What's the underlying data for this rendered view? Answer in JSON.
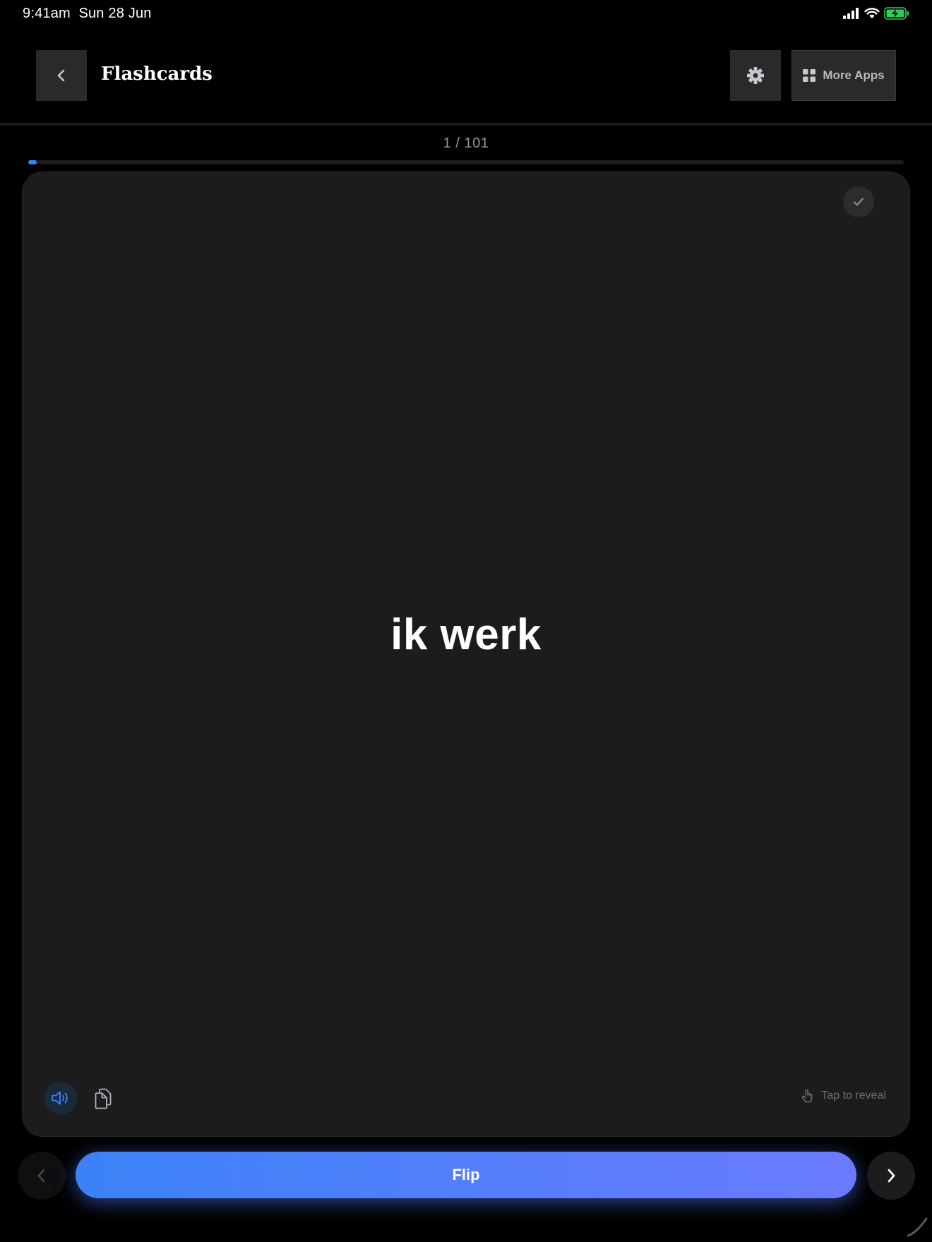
{
  "status_bar": {
    "time": "9:41am",
    "date": "Sun 28 Jun",
    "icons": [
      "cellular-signal-icon",
      "wifi-icon",
      "battery-charging-icon"
    ]
  },
  "header": {
    "title": "Flashcards",
    "back_icon": "chevron-left-icon",
    "settings_icon": "gear-icon",
    "more_apps_label": "More Apps",
    "more_apps_icon": "grid-icon"
  },
  "progress": {
    "label": "1 / 101",
    "current": 1,
    "total": 101,
    "fraction": 0.0099,
    "color": "#3b82f6"
  },
  "card": {
    "word": "ik werk",
    "mark_known_icon": "check-icon",
    "audio_icon": "speaker-icon",
    "copy_icon": "copy-icon",
    "reveal_hint": "Tap to reveal",
    "reveal_icon": "tap-hand-icon",
    "background": "#1c1c1e"
  },
  "footer": {
    "prev_icon": "chevron-left-icon",
    "flip_label": "Flip",
    "next_icon": "chevron-right-icon",
    "flip_gradient": [
      "#3b82f6",
      "#6b7bff"
    ]
  },
  "colors": {
    "background": "#000000",
    "accent": "#3b82f6",
    "battery": "#34c759"
  }
}
